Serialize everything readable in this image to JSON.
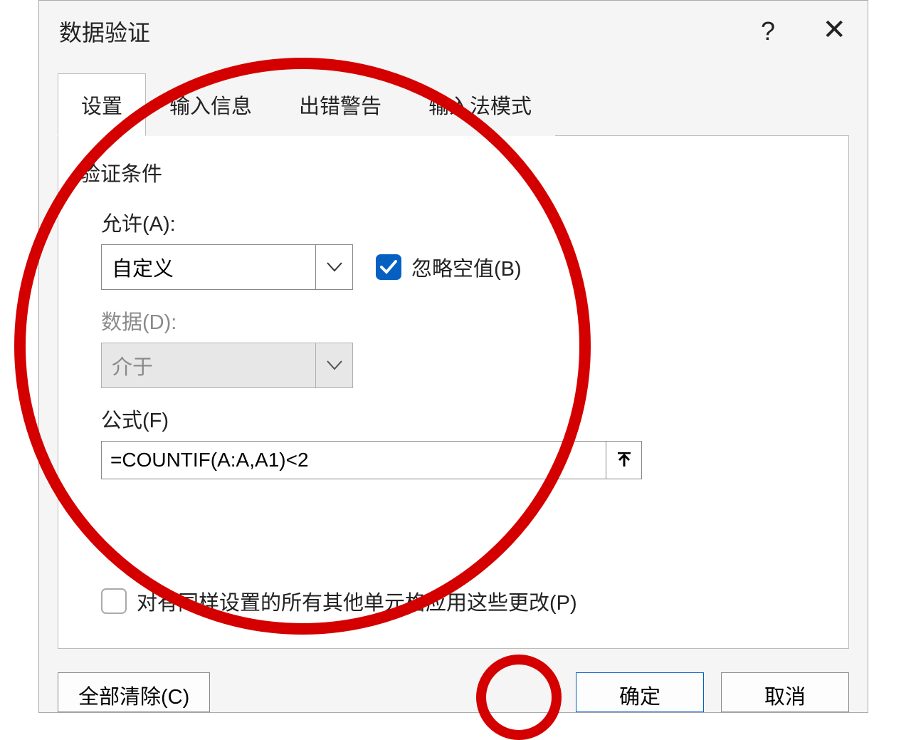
{
  "dialog": {
    "title": "数据验证",
    "tabs": [
      "设置",
      "输入信息",
      "出错警告",
      "输入法模式"
    ],
    "active_tab": 0,
    "section_label": "验证条件",
    "allow": {
      "label": "允许(A):",
      "value": "自定义"
    },
    "ignore_blank": {
      "label": "忽略空值(B)",
      "checked": true
    },
    "data": {
      "label": "数据(D):",
      "value": "介于",
      "disabled": true
    },
    "formula": {
      "label": "公式(F)",
      "value": "=COUNTIF(A:A,A1)<2"
    },
    "apply_all": {
      "label": "对有同样设置的所有其他单元格应用这些更改(P)",
      "checked": false
    },
    "buttons": {
      "clear_all": "全部清除(C)",
      "ok": "确定",
      "cancel": "取消"
    }
  }
}
